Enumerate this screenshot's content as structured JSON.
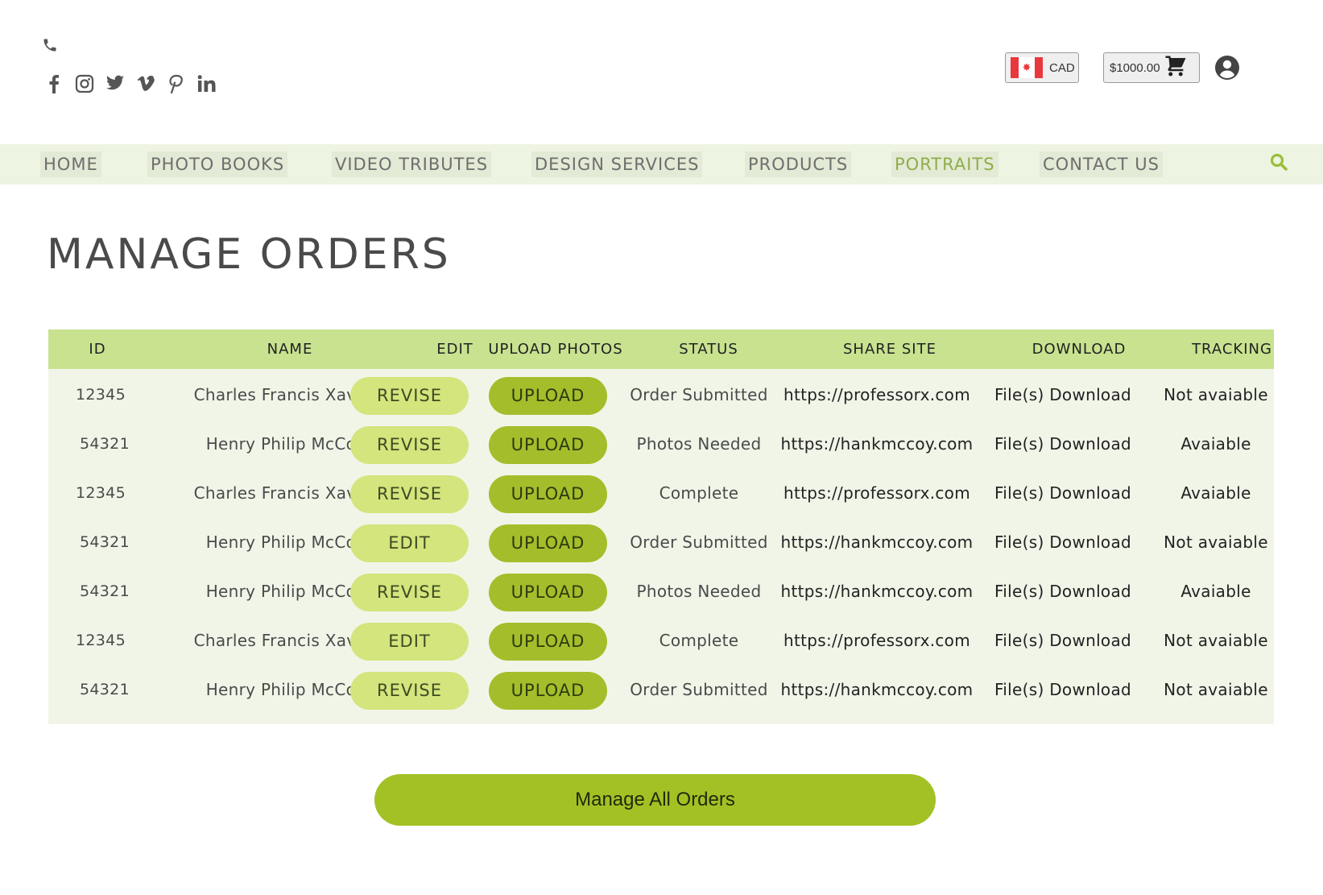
{
  "header": {
    "currency": {
      "code": "CAD",
      "flag_glyph": "✸"
    },
    "cart": {
      "total": "$1000.00"
    },
    "icons": {
      "phone": "phone-icon",
      "social": [
        "facebook-icon",
        "instagram-icon",
        "twitter-icon",
        "vimeo-icon",
        "pinterest-icon",
        "linkedin-icon"
      ],
      "account": "account-icon",
      "cart": "cart-icon"
    }
  },
  "nav": {
    "items": [
      {
        "label": "HOME"
      },
      {
        "label": "PHOTO BOOKS"
      },
      {
        "label": "VIDEO TRIBUTES"
      },
      {
        "label": "DESIGN SERVICES"
      },
      {
        "label": "PRODUCTS"
      },
      {
        "label": "PORTRAITS",
        "active": true
      },
      {
        "label": "CONTACT US"
      }
    ],
    "accent_color": "#8fae48"
  },
  "page": {
    "title": "MANAGE ORDERS"
  },
  "table": {
    "columns": [
      "ID",
      "NAME",
      "EDIT",
      "UPLOAD PHOTOS",
      "STATUS",
      "SHARE SITE",
      "DOWNLOAD",
      "TRACKING"
    ],
    "rows": [
      {
        "id": "12345",
        "name": "Charles Francis Xavier",
        "edit": "REVISE",
        "upload": "UPLOAD",
        "status": "Order Submitted",
        "share": "https://professorx.com",
        "download": "File(s) Download",
        "tracking": "Not avaiable"
      },
      {
        "id": "54321",
        "name": "Henry Philip McCoy",
        "edit": "REVISE",
        "upload": "UPLOAD",
        "status": "Photos Needed",
        "share": "https://hankmccoy.com",
        "download": "File(s) Download",
        "tracking": "Avaiable"
      },
      {
        "id": "12345",
        "name": "Charles Francis Xavier",
        "edit": "REVISE",
        "upload": "UPLOAD",
        "status": "Complete",
        "share": "https://professorx.com",
        "download": "File(s) Download",
        "tracking": "Avaiable"
      },
      {
        "id": "54321",
        "name": "Henry Philip McCoy",
        "edit": "EDIT",
        "upload": "UPLOAD",
        "status": "Order Submitted",
        "share": "https://hankmccoy.com",
        "download": "File(s) Download",
        "tracking": "Not avaiable"
      },
      {
        "id": "54321",
        "name": "Henry Philip McCoy",
        "edit": "REVISE",
        "upload": "UPLOAD",
        "status": "Photos Needed",
        "share": "https://hankmccoy.com",
        "download": "File(s) Download",
        "tracking": "Avaiable"
      },
      {
        "id": "12345",
        "name": "Charles Francis Xavier",
        "edit": "EDIT",
        "upload": "UPLOAD",
        "status": "Complete",
        "share": "https://professorx.com",
        "download": "File(s) Download",
        "tracking": "Not avaiable"
      },
      {
        "id": "54321",
        "name": "Henry Philip McCoy",
        "edit": "REVISE",
        "upload": "UPLOAD",
        "status": "Order Submitted",
        "share": "https://hankmccoy.com",
        "download": "File(s) Download",
        "tracking": "Not avaiable"
      }
    ]
  },
  "actions": {
    "manage_all_label": "Manage All Orders"
  },
  "colors": {
    "header_row": "#c8e290",
    "table_bg": "#f1f5e8",
    "revise_pill": "#d3e57c",
    "upload_pill": "#a3be2a",
    "primary_button": "#a3c125"
  }
}
